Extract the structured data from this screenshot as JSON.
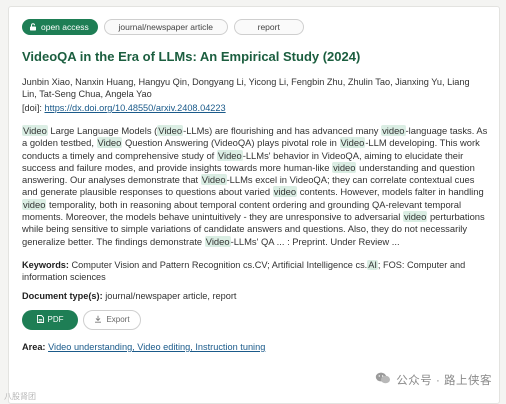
{
  "tags": {
    "open_access": "open access",
    "journal": "journal/newspaper article",
    "report": "report"
  },
  "title": "VideoQA in the Era of LLMs: An Empirical Study (2024)",
  "authors": "Junbin Xiao, Nanxin Huang, Hangyu Qin, Dongyang Li, Yicong Li, Fengbin Zhu, Zhulin Tao, Jianxing Yu, Liang Lin, Tat-Seng Chua, Angela Yao",
  "doi": {
    "label": "[doi]:",
    "link": "https://dx.doi.org/10.48550/arxiv.2408.04223"
  },
  "abstract": {
    "parts": [
      {
        "t": "Video",
        "hl": true
      },
      {
        "t": " Large Language Models (",
        "hl": false
      },
      {
        "t": "Video",
        "hl": true
      },
      {
        "t": "-LLMs) are flourishing and has advanced many ",
        "hl": false
      },
      {
        "t": "video",
        "hl": true
      },
      {
        "t": "-language tasks. As a golden testbed, ",
        "hl": false
      },
      {
        "t": "Video",
        "hl": true
      },
      {
        "t": " Question Answering (VideoQA) plays pivotal role in ",
        "hl": false
      },
      {
        "t": "Video",
        "hl": true
      },
      {
        "t": "-LLM developing. This work conducts a timely and comprehensive study of ",
        "hl": false
      },
      {
        "t": "Video",
        "hl": true
      },
      {
        "t": "-LLMs' behavior in VideoQA, aiming to elucidate their success and failure modes, and provide insights towards more human-like ",
        "hl": false
      },
      {
        "t": "video",
        "hl": true
      },
      {
        "t": " understanding and question answering. Our analyses demonstrate that ",
        "hl": false
      },
      {
        "t": "Video",
        "hl": true
      },
      {
        "t": "-LLMs excel in VideoQA; they can correlate contextual cues and generate plausible responses to questions about varied ",
        "hl": false
      },
      {
        "t": "video",
        "hl": true
      },
      {
        "t": " contents. However, models falter in handling ",
        "hl": false
      },
      {
        "t": "video",
        "hl": true
      },
      {
        "t": " temporality, both in reasoning about temporal content ordering and grounding QA-relevant temporal moments. Moreover, the models behave unintuitively - they are unresponsive to adversarial ",
        "hl": false
      },
      {
        "t": "video",
        "hl": true
      },
      {
        "t": " perturbations while being sensitive to simple variations of candidate answers and questions. Also, they do not necessarily generalize better. The findings demonstrate ",
        "hl": false
      },
      {
        "t": "Video",
        "hl": true
      },
      {
        "t": "-LLMs' QA ... : Preprint. Under Review ...",
        "hl": false
      }
    ]
  },
  "keywords": {
    "label": "Keywords:",
    "text_before": " Computer Vision and Pattern Recognition cs.CV; Artificial Intelligence cs.",
    "highlight": "AI",
    "text_after": "; FOS: Computer and information sciences"
  },
  "doc_types": {
    "label": "Document type(s):",
    "value": " journal/newspaper article, report"
  },
  "buttons": {
    "pdf": "PDF",
    "export": "Export"
  },
  "area": {
    "label": "Area:",
    "value": "Video understanding, Video editing, Instruction tuning"
  },
  "watermark": "公众号 · 路上侠客",
  "watermark_small": "八股肾团",
  "colors": {
    "accent": "#1e7e55",
    "title": "#1b5e3f",
    "highlight": "#dbeee4",
    "link": "#1a5a8a"
  }
}
